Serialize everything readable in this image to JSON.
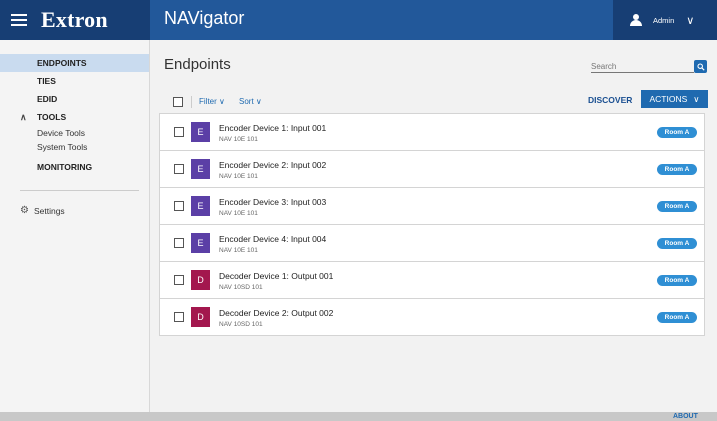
{
  "brand": {
    "name": "Extron",
    "menu_icon": "hamburger-icon"
  },
  "header": {
    "app_title": "NAVigator",
    "user": {
      "name": "Admin",
      "icon": "user-icon",
      "menu_icon": "chevron-down-icon"
    }
  },
  "sidebar": {
    "items": [
      {
        "label": "ENDPOINTS",
        "active": true
      },
      {
        "label": "TIES"
      },
      {
        "label": "EDID"
      }
    ],
    "tools": {
      "label": "TOOLS",
      "expanded": true,
      "icon": "chevron-up-icon",
      "children": [
        "Device Tools",
        "System Tools"
      ]
    },
    "monitoring": {
      "label": "MONITORING"
    },
    "settings": {
      "label": "Settings",
      "icon": "gear-icon"
    }
  },
  "main": {
    "title": "Endpoints",
    "search": {
      "placeholder": "Search",
      "icon": "search-icon"
    },
    "toolbar": {
      "filter_label": "Filter",
      "sort_label": "Sort",
      "discover_label": "DISCOVER",
      "actions_label": "ACTIONS"
    },
    "endpoints": [
      {
        "initial": "E",
        "name": "Encoder Device 1: Input 001",
        "model": "NAV 10E 101",
        "room": "Room A",
        "color": "#5b3fa6"
      },
      {
        "initial": "E",
        "name": "Encoder Device 2: Input 002",
        "model": "NAV 10E 101",
        "room": "Room A",
        "color": "#5b3fa6"
      },
      {
        "initial": "E",
        "name": "Encoder Device 3: Input 003",
        "model": "NAV 10E 101",
        "room": "Room A",
        "color": "#5b3fa6"
      },
      {
        "initial": "E",
        "name": "Encoder Device 4: Input 004",
        "model": "NAV 10E 101",
        "room": "Room A",
        "color": "#5b3fa6"
      },
      {
        "initial": "D",
        "name": "Decoder Device 1: Output 001",
        "model": "NAV 10SD 101",
        "room": "Room A",
        "color": "#a3174e"
      },
      {
        "initial": "D",
        "name": "Decoder Device 2: Output 002",
        "model": "NAV 10SD 101",
        "room": "Room A",
        "color": "#a3174e"
      }
    ]
  },
  "footer": {
    "about_label": "ABOUT"
  },
  "colors": {
    "header_blue": "#22589a",
    "brand_navy": "#173e74",
    "accent_blue": "#1f6ab0",
    "badge_blue": "#2f8fd4",
    "active_nav": "#c9dbef"
  }
}
